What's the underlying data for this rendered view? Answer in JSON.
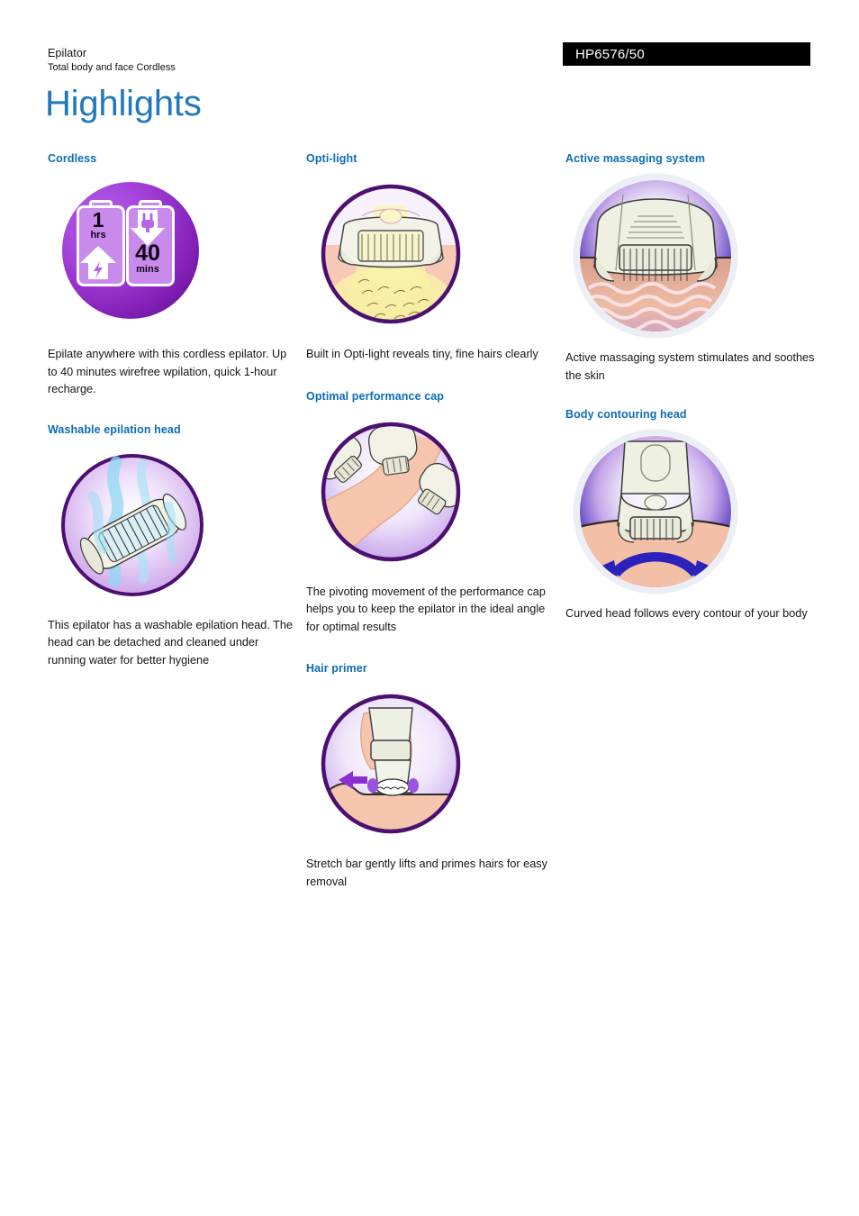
{
  "header": {
    "category": "Epilator",
    "subtitle": "Total body and face Cordless",
    "product_code": "HP6576/50",
    "page_title": "Highlights"
  },
  "colors": {
    "heading_blue": "#0b6cb5",
    "title_blue": "#2179b9",
    "code_bar_bg": "#000000",
    "code_bar_text": "#ffffff",
    "circle_purple_border": "#4b1070",
    "cordless_ball": "#8320b8",
    "arrow_blue": "#2a22bb",
    "arrow_purple": "#8a2fd0",
    "light_yellow": "#f5ec8a",
    "skin": "#f3bda6"
  },
  "columns": [
    {
      "id": "column-1",
      "sections": [
        {
          "id": "cordless",
          "heading": "Cordless",
          "body": "Epilate anywhere with this cordless epilator. Up to 40 minutes wirefree wpilation, quick 1-hour recharge.",
          "figure": {
            "name": "cordless-battery-icon",
            "labels": {
              "charge_value": "1",
              "charge_unit": "hrs",
              "runtime_value": "40",
              "runtime_unit": "mins"
            }
          }
        },
        {
          "id": "washable-epilation-head",
          "heading": "Washable epilation head",
          "body": "This epilator has a washable epilation head. The head can be detached and cleaned under running water for better hygiene",
          "figure": {
            "name": "epilation-head-under-water-icon",
            "labels": {}
          }
        }
      ]
    },
    {
      "id": "column-2",
      "sections": [
        {
          "id": "opti-light",
          "heading": "Opti-light",
          "body": "Built in Opti-light reveals tiny, fine hairs clearly",
          "figure": {
            "name": "opti-light-beam-on-skin-icon",
            "labels": {}
          }
        },
        {
          "id": "optimal-performance-cap",
          "heading": "Optimal performance cap",
          "body": "The pivoting movement of the performance cap helps you to keep the epilator in the ideal angle for optimal results",
          "figure": {
            "name": "pivoting-cap-on-leg-icon",
            "labels": {}
          }
        },
        {
          "id": "hair-primer",
          "heading": "Hair primer",
          "body": "Stretch bar gently lifts and primes hairs for easy removal",
          "figure": {
            "name": "stretch-bar-on-skin-icon",
            "labels": {}
          }
        }
      ]
    },
    {
      "id": "column-3",
      "sections": [
        {
          "id": "active-massaging-system",
          "heading": "Active massaging system",
          "body": "Active massaging system stimulates and soothes the skin",
          "figure": {
            "name": "massaging-waves-on-skin-icon",
            "labels": {}
          }
        },
        {
          "id": "body-contouring-head",
          "heading": "Body contouring head",
          "body": "Curved head follows every contour of your body",
          "figure": {
            "name": "contouring-head-arrow-icon",
            "labels": {}
          }
        }
      ]
    }
  ]
}
